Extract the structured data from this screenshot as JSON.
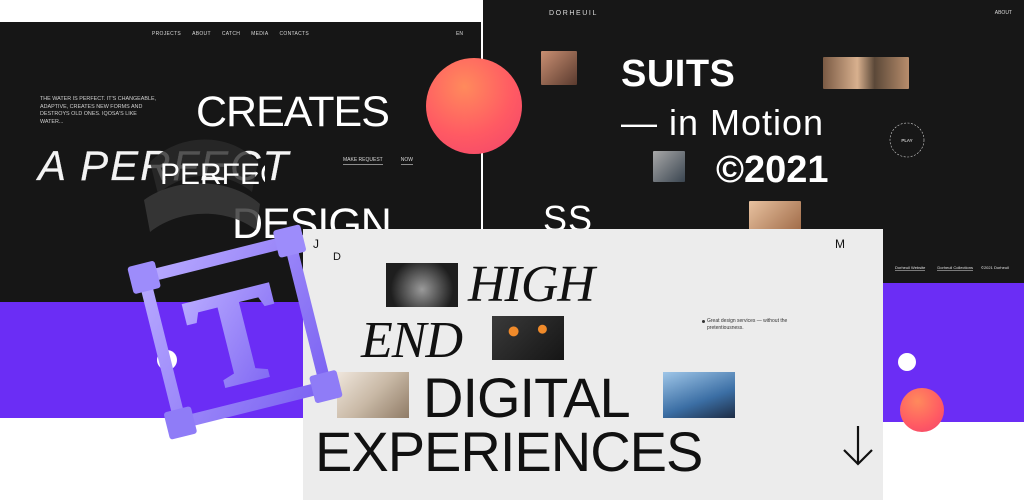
{
  "left_panel": {
    "nav": [
      "PROJECTS",
      "ABOUT",
      "CATCH",
      "MEDIA",
      "CONTACTS"
    ],
    "lang": "EN",
    "tagline": "THE WATER IS PERFECT. IT'S CHANGEABLE, ADAPTIVE, CREATES NEW FORMS AND DESTROYS OLD ONES. IQOSA'S LIKE WATER...",
    "headline_line1": "CREATES",
    "headline_line2": "A PERFECT",
    "headline_line3": "DESIGN",
    "ribbon_text": "PERFECT",
    "cta_request": "MAKE REQUEST",
    "cta_now": "NOW"
  },
  "right_panel": {
    "brand": "DORHEUIL",
    "about": "ABOUT",
    "headline_line1": "SUITS",
    "headline_line2": "— in Motion",
    "headline_line3": "©2021",
    "partial_text": "SS",
    "play_label": "PLAY",
    "footer_links": [
      "Dorheuil Website",
      "Dorheuil Collections"
    ],
    "copyright": "©2021 Dorheuil"
  },
  "center_panel": {
    "corner_j": "J",
    "corner_d": "D",
    "corner_m": "M",
    "headline_high": "HIGH",
    "headline_end": "END",
    "headline_digital": "DIGITAL",
    "headline_experiences": "EXPERIENCES",
    "blurb": "Great design services — without the pretentiousness."
  },
  "colors": {
    "purple": "#6b2df5",
    "coral": "#ff5a63",
    "dark": "#161616",
    "light": "#ececec"
  },
  "icons": [
    "t-logo-icon",
    "arrow-down-icon",
    "play-ring-icon"
  ]
}
